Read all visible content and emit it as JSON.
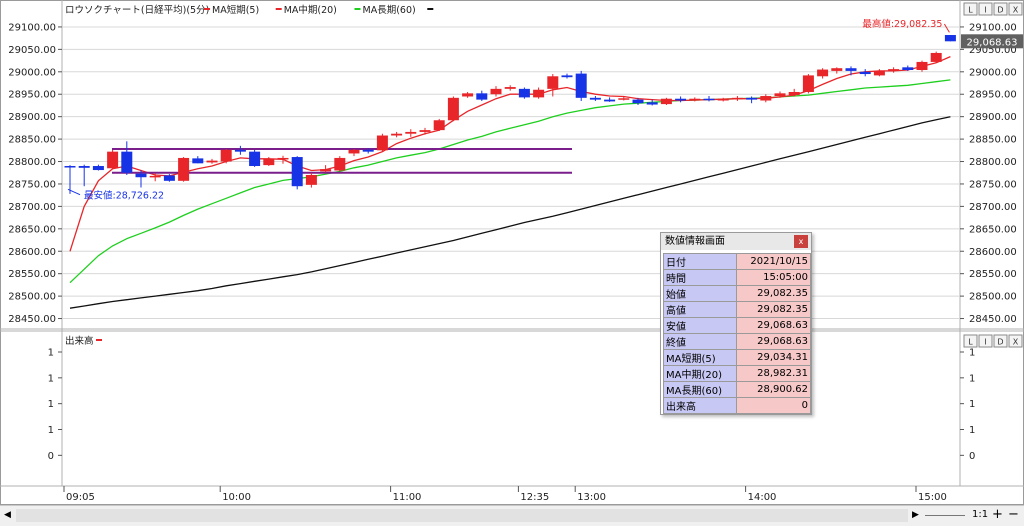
{
  "chart_data": {
    "type": "candlestick",
    "title": "ロウソクチャート(日経平均)(5分)",
    "legend": [
      {
        "name": "MA短期(5)",
        "color": "#e8262a"
      },
      {
        "name": "MA中期(20)",
        "color": "#e8262a"
      },
      {
        "name": "MA長期(60)",
        "color": "#1fcf1f"
      }
    ],
    "legend_tail_color": "#111111",
    "ylim": [
      28420,
      29140
    ],
    "y_ticks": [
      "29100.00",
      "29050.00",
      "29000.00",
      "28950.00",
      "28900.00",
      "28850.00",
      "28800.00",
      "28750.00",
      "28700.00",
      "28650.00",
      "28600.00",
      "28550.00",
      "28500.00",
      "28450.00"
    ],
    "x_ticks": [
      "09:05",
      "10:00",
      "11:00",
      "12:35",
      "13:00",
      "14:00",
      "15:00"
    ],
    "last_price_tag": "29,068.63",
    "high_annotation": "最高値:29,082.35",
    "low_annotation": "最安値:28,726.22",
    "range_lines": [
      28828,
      28775
    ],
    "candles": [
      {
        "o": 28790,
        "h": 28792,
        "l": 28728,
        "c": 28788
      },
      {
        "o": 28790,
        "h": 28793,
        "l": 28745,
        "c": 28786
      },
      {
        "o": 28790,
        "h": 28793,
        "l": 28780,
        "c": 28781
      },
      {
        "o": 28785,
        "h": 28826,
        "l": 28783,
        "c": 28822
      },
      {
        "o": 28822,
        "h": 28845,
        "l": 28770,
        "c": 28775
      },
      {
        "o": 28773,
        "h": 28780,
        "l": 28742,
        "c": 28765
      },
      {
        "o": 28766,
        "h": 28774,
        "l": 28756,
        "c": 28768
      },
      {
        "o": 28769,
        "h": 28772,
        "l": 28755,
        "c": 28757
      },
      {
        "o": 28757,
        "h": 28810,
        "l": 28755,
        "c": 28808
      },
      {
        "o": 28807,
        "h": 28812,
        "l": 28796,
        "c": 28796
      },
      {
        "o": 28798,
        "h": 28806,
        "l": 28795,
        "c": 28802
      },
      {
        "o": 28800,
        "h": 28828,
        "l": 28796,
        "c": 28826
      },
      {
        "o": 28826,
        "h": 28835,
        "l": 28815,
        "c": 28822
      },
      {
        "o": 28822,
        "h": 28826,
        "l": 28788,
        "c": 28790
      },
      {
        "o": 28792,
        "h": 28810,
        "l": 28790,
        "c": 28805
      },
      {
        "o": 28806,
        "h": 28813,
        "l": 28795,
        "c": 28808
      },
      {
        "o": 28810,
        "h": 28812,
        "l": 28738,
        "c": 28745
      },
      {
        "o": 28748,
        "h": 28775,
        "l": 28742,
        "c": 28770
      },
      {
        "o": 28778,
        "h": 28792,
        "l": 28776,
        "c": 28783
      },
      {
        "o": 28780,
        "h": 28812,
        "l": 28778,
        "c": 28808
      },
      {
        "o": 28818,
        "h": 28828,
        "l": 28812,
        "c": 28826
      },
      {
        "o": 28826,
        "h": 28830,
        "l": 28818,
        "c": 28822
      },
      {
        "o": 28825,
        "h": 28862,
        "l": 28822,
        "c": 28858
      },
      {
        "o": 28858,
        "h": 28866,
        "l": 28854,
        "c": 28862
      },
      {
        "o": 28862,
        "h": 28872,
        "l": 28855,
        "c": 28866
      },
      {
        "o": 28866,
        "h": 28875,
        "l": 28860,
        "c": 28870
      },
      {
        "o": 28870,
        "h": 28895,
        "l": 28868,
        "c": 28892
      },
      {
        "o": 28892,
        "h": 28945,
        "l": 28890,
        "c": 28942
      },
      {
        "o": 28945,
        "h": 28955,
        "l": 28942,
        "c": 28952
      },
      {
        "o": 28952,
        "h": 28958,
        "l": 28935,
        "c": 28938
      },
      {
        "o": 28950,
        "h": 28968,
        "l": 28945,
        "c": 28962
      },
      {
        "o": 28962,
        "h": 28970,
        "l": 28958,
        "c": 28966
      },
      {
        "o": 28962,
        "h": 28965,
        "l": 28940,
        "c": 28943
      },
      {
        "o": 28943,
        "h": 28965,
        "l": 28940,
        "c": 28960
      },
      {
        "o": 28962,
        "h": 28995,
        "l": 28945,
        "c": 28990
      },
      {
        "o": 28992,
        "h": 28996,
        "l": 28985,
        "c": 28988
      },
      {
        "o": 28996,
        "h": 29002,
        "l": 28935,
        "c": 28942
      },
      {
        "o": 28942,
        "h": 28946,
        "l": 28935,
        "c": 28938
      },
      {
        "o": 28938,
        "h": 28943,
        "l": 28933,
        "c": 28934
      },
      {
        "o": 28940,
        "h": 28945,
        "l": 28936,
        "c": 28941
      },
      {
        "o": 28938,
        "h": 28942,
        "l": 28926,
        "c": 28930
      },
      {
        "o": 28932,
        "h": 28938,
        "l": 28925,
        "c": 28927
      },
      {
        "o": 28928,
        "h": 28942,
        "l": 28926,
        "c": 28940
      },
      {
        "o": 28940,
        "h": 28945,
        "l": 28932,
        "c": 28936
      },
      {
        "o": 28938,
        "h": 28943,
        "l": 28934,
        "c": 28940
      },
      {
        "o": 28940,
        "h": 28946,
        "l": 28934,
        "c": 28938
      },
      {
        "o": 28936,
        "h": 28942,
        "l": 28934,
        "c": 28940
      },
      {
        "o": 28940,
        "h": 28946,
        "l": 28935,
        "c": 28942
      },
      {
        "o": 28942,
        "h": 28945,
        "l": 28930,
        "c": 28938
      },
      {
        "o": 28936,
        "h": 28950,
        "l": 28932,
        "c": 28946
      },
      {
        "o": 28946,
        "h": 28956,
        "l": 28942,
        "c": 28952
      },
      {
        "o": 28948,
        "h": 28962,
        "l": 28945,
        "c": 28955
      },
      {
        "o": 28955,
        "h": 28995,
        "l": 28952,
        "c": 28992
      },
      {
        "o": 28990,
        "h": 29008,
        "l": 28985,
        "c": 29005
      },
      {
        "o": 29002,
        "h": 29010,
        "l": 28996,
        "c": 29008
      },
      {
        "o": 29008,
        "h": 29012,
        "l": 28992,
        "c": 29002
      },
      {
        "o": 29000,
        "h": 29006,
        "l": 28990,
        "c": 28995
      },
      {
        "o": 28992,
        "h": 29006,
        "l": 28990,
        "c": 29002
      },
      {
        "o": 29002,
        "h": 29010,
        "l": 28998,
        "c": 29006
      },
      {
        "o": 29010,
        "h": 29014,
        "l": 29002,
        "c": 29004
      },
      {
        "o": 29004,
        "h": 29025,
        "l": 29000,
        "c": 29022
      },
      {
        "o": 29022,
        "h": 29045,
        "l": 29020,
        "c": 29042
      },
      {
        "o": 29082,
        "h": 29082,
        "l": 29068,
        "c": 29068
      }
    ],
    "ma_short": [
      28600,
      28700,
      28757,
      28784,
      28790,
      28780,
      28770,
      28768,
      28776,
      28784,
      28790,
      28800,
      28808,
      28806,
      28806,
      28805,
      28790,
      28780,
      28782,
      28790,
      28802,
      28810,
      28822,
      28840,
      28852,
      28862,
      28870,
      28892,
      28912,
      28926,
      28940,
      28950,
      28950,
      28950,
      28960,
      28965,
      28956,
      28950,
      28946,
      28945,
      28940,
      28938,
      28936,
      28936,
      28937,
      28938,
      28939,
      28940,
      28940,
      28941,
      28944,
      28948,
      28958,
      28972,
      28985,
      28995,
      29000,
      29002,
      29002,
      29004,
      29012,
      29020,
      29034
    ],
    "ma_mid": [
      28530,
      28560,
      28590,
      28612,
      28628,
      28640,
      28652,
      28665,
      28680,
      28694,
      28706,
      28718,
      28730,
      28742,
      28750,
      28758,
      28762,
      28766,
      28772,
      28778,
      28786,
      28792,
      28800,
      28808,
      28814,
      28820,
      28828,
      28838,
      28848,
      28856,
      28866,
      28874,
      28882,
      28890,
      28900,
      28908,
      28914,
      28920,
      28924,
      28928,
      28930,
      28932,
      28934,
      28936,
      28937,
      28938,
      28939,
      28940,
      28941,
      28942,
      28944,
      28946,
      28948,
      28952,
      28956,
      28960,
      28964,
      28966,
      28968,
      28970,
      28974,
      28978,
      28982
    ],
    "ma_long": [
      28473,
      28478,
      28483,
      28488,
      28492,
      28496,
      28500,
      28504,
      28508,
      28512,
      28517,
      28523,
      28528,
      28533,
      28538,
      28543,
      28548,
      28554,
      28561,
      28568,
      28575,
      28582,
      28589,
      28596,
      28603,
      28610,
      28617,
      28624,
      28632,
      28640,
      28648,
      28656,
      28664,
      28671,
      28678,
      28686,
      28694,
      28702,
      28710,
      28718,
      28726,
      28734,
      28742,
      28750,
      28758,
      28766,
      28774,
      28782,
      28790,
      28798,
      28806,
      28814,
      28822,
      28830,
      28838,
      28846,
      28854,
      28862,
      28870,
      28878,
      28886,
      28893,
      28900
    ],
    "volume_pane": {
      "label": "出来高",
      "ylim": [
        -0.2,
        1.3
      ],
      "y_ticks": [
        1,
        1,
        1,
        1,
        0
      ],
      "y_tick_values": [
        1.0,
        0.75,
        0.5,
        0.25,
        0.0
      ]
    }
  },
  "colors": {
    "up": "#e8262a",
    "down": "#1733e6",
    "range_line": "#7a1e8c",
    "grid": "#d8d8d8",
    "separator": "#b0b0b0"
  },
  "info_panel": {
    "title": "数値情報画面",
    "close_label": "x",
    "rows": [
      {
        "label": "日付",
        "value": "2021/10/15"
      },
      {
        "label": "時間",
        "value": "15:05:00"
      },
      {
        "label": "始値",
        "value": "29,082.35"
      },
      {
        "label": "高値",
        "value": "29,082.35"
      },
      {
        "label": "安値",
        "value": "29,068.63"
      },
      {
        "label": "終値",
        "value": "29,068.63"
      },
      {
        "label": "MA短期(5)",
        "value": "29,034.31"
      },
      {
        "label": "MA中期(20)",
        "value": "28,982.31"
      },
      {
        "label": "MA長期(60)",
        "value": "28,900.62"
      },
      {
        "label": "出来高",
        "value": "0"
      }
    ]
  },
  "pane_buttons": [
    "L",
    "I",
    "D",
    "X"
  ],
  "scrollbar": {
    "zoom_label": "1:1",
    "plus": "+",
    "minus": "−"
  }
}
